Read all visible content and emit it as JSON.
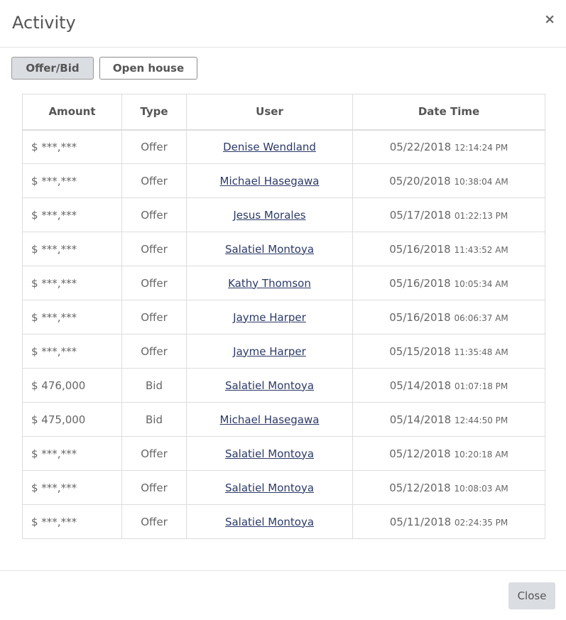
{
  "modal": {
    "title": "Activity",
    "close_glyph": "×"
  },
  "tabs": [
    {
      "label": "Offer/Bid",
      "active": true
    },
    {
      "label": "Open house",
      "active": false
    }
  ],
  "table": {
    "headers": [
      "Amount",
      "Type",
      "User",
      "Date Time"
    ],
    "rows": [
      {
        "amount": "$ ***,***",
        "type": "Offer",
        "user": "Denise Wendland",
        "date": "05/22/2018",
        "time": "12:14:24 PM"
      },
      {
        "amount": "$ ***,***",
        "type": "Offer",
        "user": "Michael Hasegawa",
        "date": "05/20/2018",
        "time": "10:38:04 AM"
      },
      {
        "amount": "$ ***,***",
        "type": "Offer",
        "user": "Jesus Morales",
        "date": "05/17/2018",
        "time": "01:22:13 PM"
      },
      {
        "amount": "$ ***,***",
        "type": "Offer",
        "user": "Salatiel Montoya",
        "date": "05/16/2018",
        "time": "11:43:52 AM"
      },
      {
        "amount": "$ ***,***",
        "type": "Offer",
        "user": "Kathy Thomson",
        "date": "05/16/2018",
        "time": "10:05:34 AM"
      },
      {
        "amount": "$ ***,***",
        "type": "Offer",
        "user": "Jayme Harper",
        "date": "05/16/2018",
        "time": "06:06:37 AM"
      },
      {
        "amount": "$ ***,***",
        "type": "Offer",
        "user": "Jayme Harper",
        "date": "05/15/2018",
        "time": "11:35:48 AM"
      },
      {
        "amount": "$ 476,000",
        "type": "Bid",
        "user": "Salatiel Montoya",
        "date": "05/14/2018",
        "time": "01:07:18 PM"
      },
      {
        "amount": "$ 475,000",
        "type": "Bid",
        "user": "Michael Hasegawa",
        "date": "05/14/2018",
        "time": "12:44:50 PM"
      },
      {
        "amount": "$ ***,***",
        "type": "Offer",
        "user": "Salatiel Montoya",
        "date": "05/12/2018",
        "time": "10:20:18 AM"
      },
      {
        "amount": "$ ***,***",
        "type": "Offer",
        "user": "Salatiel Montoya",
        "date": "05/12/2018",
        "time": "10:08:03 AM"
      },
      {
        "amount": "$ ***,***",
        "type": "Offer",
        "user": "Salatiel Montoya",
        "date": "05/11/2018",
        "time": "02:24:35 PM"
      }
    ]
  },
  "footer": {
    "close_label": "Close"
  },
  "colors": {
    "link": "#2b3a67",
    "button_bg": "#dadde2",
    "border": "#dddddd"
  }
}
